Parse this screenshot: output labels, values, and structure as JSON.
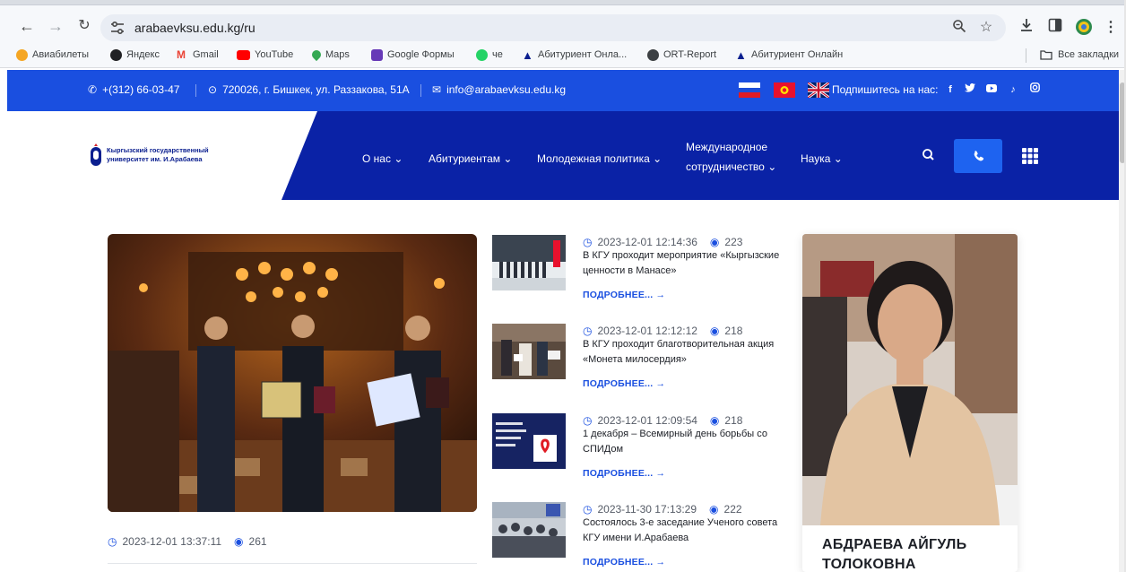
{
  "browser": {
    "url": "arabaevksu.edu.kg/ru",
    "bookmarks": [
      {
        "label": "Авиабилеты",
        "color": "#f5a623"
      },
      {
        "label": "Яндекс",
        "color": "#202124"
      },
      {
        "label": "Gmail",
        "color": "#ea4335"
      },
      {
        "label": "YouTube",
        "color": "#ff0000"
      },
      {
        "label": "Maps",
        "color": "#34a853"
      },
      {
        "label": "Google Формы",
        "color": "#673ab7"
      },
      {
        "label": "че",
        "color": "#25d366"
      },
      {
        "label": "Абитуриент Онла...",
        "color": "#0b1f8f"
      },
      {
        "label": "ORT-Report",
        "color": "#3c4043"
      },
      {
        "label": "Абитуриент Онлайн",
        "color": "#0b1f8f"
      }
    ],
    "all_bookmarks": "Все закладки"
  },
  "site": {
    "phone": "+(312) 66-03-47",
    "address": "720026, г. Бишкек, ул. Раззакова, 51А",
    "email": "info@arabaevksu.edu.kg",
    "subscribe": "Подпишитесь на нас:",
    "logo_line1": "Кыргызский государственный",
    "logo_line2": "университет им. И.Арабаева",
    "nav": {
      "about": "О нас",
      "applicants": "Абитуриентам",
      "youth": "Молодежная политика",
      "intl_1": "Международное",
      "intl_2": "сотрудничество",
      "science": "Наука"
    },
    "colors": {
      "topbar": "#1a4fe0",
      "header": "#0a22a6",
      "accent": "#1e63f0"
    }
  },
  "main_news": {
    "date": "2023-12-01 13:37:11",
    "views": "261"
  },
  "news": [
    {
      "date": "2023-12-01 12:14:36",
      "views": "223",
      "title": "В КГУ проходит мероприятие «Кыргызские ценности в Манасе»",
      "more": "ПОДРОБНЕЕ..."
    },
    {
      "date": "2023-12-01 12:12:12",
      "views": "218",
      "title": "В КГУ проходит благотворительная акция «Монета милосердия»",
      "more": "ПОДРОБНЕЕ..."
    },
    {
      "date": "2023-12-01 12:09:54",
      "views": "218",
      "title": "1 декабря – Всемирный день борьбы со СПИДом",
      "more": "ПОДРОБНЕЕ..."
    },
    {
      "date": "2023-11-30 17:13:29",
      "views": "222",
      "title": "Состоялось 3-е заседание Ученого совета КГУ имени И.Арабаева",
      "more": "ПОДРОБНЕЕ..."
    }
  ],
  "rector": {
    "name_line1": "АБДРАЕВА АЙГУЛЬ",
    "name_line2": "ТОЛОКОВНА"
  }
}
